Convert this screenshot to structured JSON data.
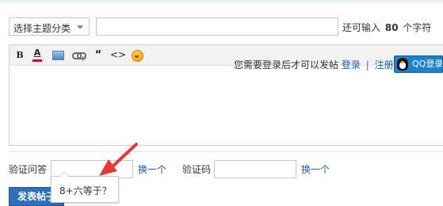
{
  "form": {
    "category_select": "选择主题分类",
    "subject_value": "",
    "limit": {
      "prefix": "还可输入",
      "count": "80",
      "suffix": "个字符"
    }
  },
  "editor": {
    "toolbar": {
      "bold": "B",
      "font_color": "A",
      "quote": "“",
      "code": "<>"
    },
    "login_prompt": "您需要登录后才可以发帖",
    "login_link": "登录",
    "separator": "|",
    "register_link": "注册",
    "qq_button": "QQ登录"
  },
  "verify": {
    "question_label": "验证问答",
    "question_value": "",
    "change_link_1": "换一个",
    "code_label": "验证码",
    "code_value": "",
    "change_link_2": "换一个",
    "popup_question": "8+六等于？"
  },
  "submit": {
    "label": "发表帖子"
  },
  "colors": {
    "link": "#1f5aa6",
    "submit_bg": "#2f6fb8",
    "annotation_arrow": "#e53935"
  },
  "icons": [
    "chevron-down-icon",
    "bold-icon",
    "font-color-icon",
    "image-icon",
    "link-icon",
    "quote-icon",
    "code-icon",
    "smiley-icon",
    "qq-penguin-icon",
    "red-arrow-annotation"
  ]
}
